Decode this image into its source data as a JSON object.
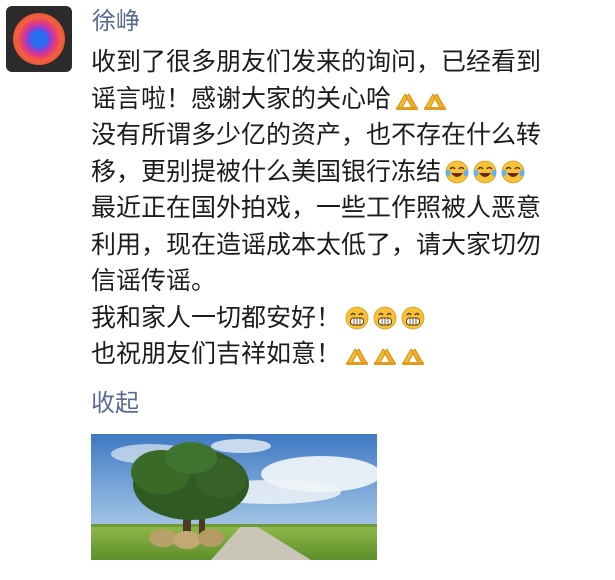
{
  "post": {
    "author": "徐峥",
    "avatar_icon": "colorful-ring-avatar-icon",
    "lines": [
      {
        "text": "收到了很多朋友们发来的询问，已经看到",
        "emojis": []
      },
      {
        "text": "谣言啦！感谢大家的关心哈",
        "emojis": [
          "folded-hands-icon",
          "folded-hands-icon"
        ]
      },
      {
        "text": "没有所谓多少亿的资产，也不存在什么转",
        "emojis": []
      },
      {
        "text": "移，更别提被什么美国银行冻结",
        "emojis": [
          "laughing-tears-icon",
          "laughing-tears-icon",
          "laughing-tears-icon"
        ]
      },
      {
        "text": "最近正在国外拍戏，一些工作照被人恶意",
        "emojis": []
      },
      {
        "text": "利用，现在造谣成本太低了，请大家切勿",
        "emojis": []
      },
      {
        "text": "信谣传谣。",
        "emojis": []
      },
      {
        "text": "我和家人一切都安好！",
        "emojis": [
          "grinning-face-icon",
          "grinning-face-icon",
          "grinning-face-icon"
        ]
      },
      {
        "text": "也祝朋友们吉祥如意！",
        "emojis": [
          "folded-hands-icon",
          "folded-hands-icon",
          "folded-hands-icon"
        ]
      }
    ],
    "collapse_label": "收起",
    "photo_icon": "landscape-tree-photo"
  },
  "colors": {
    "name_blue": "#5a6b93",
    "text": "#1c1c1c",
    "emoji_yellow": "#f5b82e"
  }
}
